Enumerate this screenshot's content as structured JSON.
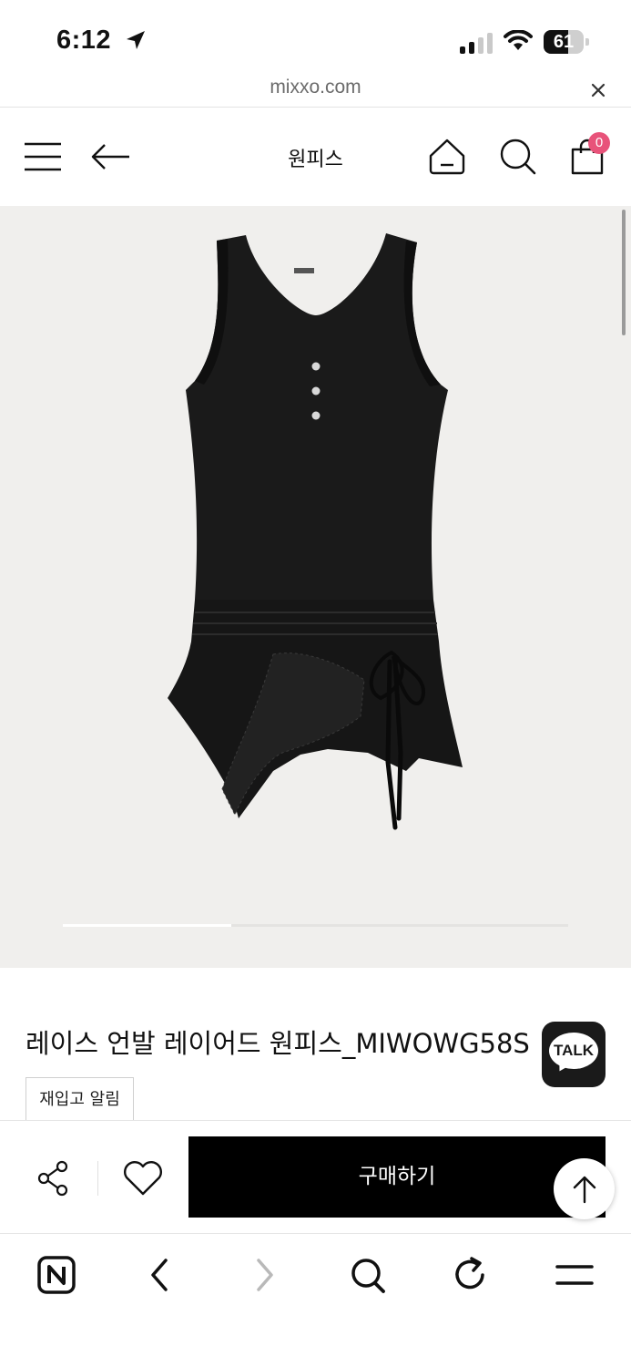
{
  "status_bar": {
    "time": "6:12",
    "battery": "61",
    "battery_level": 0.61,
    "icons": [
      "location-arrow-icon",
      "cellular-signal-icon",
      "wifi-icon",
      "battery-icon"
    ]
  },
  "browser": {
    "url": "mixxo.com",
    "close_icon": "close-icon"
  },
  "header": {
    "title": "원피스",
    "cart_count": "0",
    "icons": [
      "menu-icon",
      "back-arrow-icon",
      "home-icon",
      "search-icon",
      "shopping-bag-icon"
    ]
  },
  "gallery": {
    "image": "black sleeveless lace-trim layered dress",
    "slide_position": 1,
    "slide_count": 3
  },
  "product": {
    "name": "레이스 언발 레이어드 원피스_MIWOWG58S",
    "restock_label": "재입고 알림"
  },
  "chat": {
    "label": "TALK"
  },
  "purchase_bar": {
    "buy_label": "구매하기",
    "icons": [
      "share-icon",
      "heart-icon",
      "scroll-top-icon"
    ]
  },
  "toolbar": {
    "icons": [
      "naver-n-icon",
      "chevron-left-icon",
      "chevron-right-icon",
      "search-icon",
      "refresh-icon",
      "menu-icon"
    ]
  },
  "colors": {
    "accent_badge": "#e8537a",
    "gallery_bg": "#f0efed",
    "buy_button": "#000000",
    "talk_button": "#1a1a1a"
  }
}
